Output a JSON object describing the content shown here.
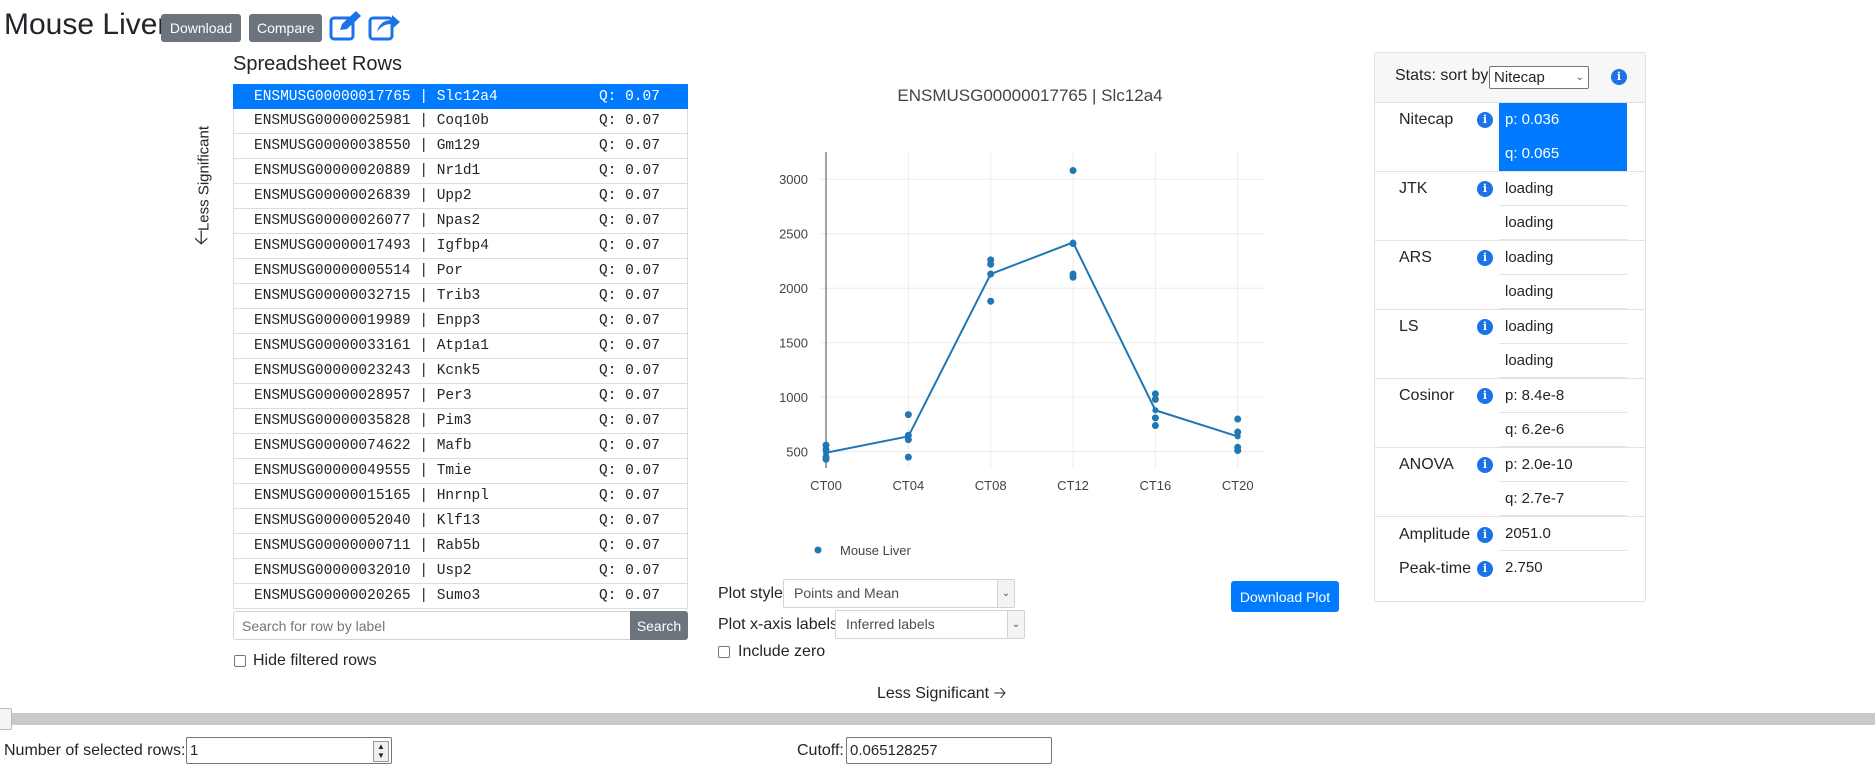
{
  "header": {
    "title": "Mouse Liver",
    "download_label": "Download",
    "compare_label": "Compare",
    "edit_icon": "edit-icon",
    "share_icon": "share-icon"
  },
  "spreadsheet": {
    "heading": "Spreadsheet Rows",
    "less_significant": "Less Significant",
    "rows": [
      {
        "label": "ENSMUSG00000017765 | Slc12a4",
        "q": "Q: 0.07",
        "selected": true
      },
      {
        "label": "ENSMUSG00000025981 | Coq10b",
        "q": "Q: 0.07"
      },
      {
        "label": "ENSMUSG00000038550 | Gm129",
        "q": "Q: 0.07"
      },
      {
        "label": "ENSMUSG00000020889 | Nr1d1",
        "q": "Q: 0.07"
      },
      {
        "label": "ENSMUSG00000026839 | Upp2",
        "q": "Q: 0.07"
      },
      {
        "label": "ENSMUSG00000026077 | Npas2",
        "q": "Q: 0.07"
      },
      {
        "label": "ENSMUSG00000017493 | Igfbp4",
        "q": "Q: 0.07"
      },
      {
        "label": "ENSMUSG00000005514 | Por",
        "q": "Q: 0.07"
      },
      {
        "label": "ENSMUSG00000032715 | Trib3",
        "q": "Q: 0.07"
      },
      {
        "label": "ENSMUSG00000019989 | Enpp3",
        "q": "Q: 0.07"
      },
      {
        "label": "ENSMUSG00000033161 | Atp1a1",
        "q": "Q: 0.07"
      },
      {
        "label": "ENSMUSG00000023243 | Kcnk5",
        "q": "Q: 0.07"
      },
      {
        "label": "ENSMUSG00000028957 | Per3",
        "q": "Q: 0.07"
      },
      {
        "label": "ENSMUSG00000035828 | Pim3",
        "q": "Q: 0.07"
      },
      {
        "label": "ENSMUSG00000074622 | Mafb",
        "q": "Q: 0.07"
      },
      {
        "label": "ENSMUSG00000049555 | Tmie",
        "q": "Q: 0.07"
      },
      {
        "label": "ENSMUSG00000015165 | Hnrnpl",
        "q": "Q: 0.07"
      },
      {
        "label": "ENSMUSG00000052040 | Klf13",
        "q": "Q: 0.07"
      },
      {
        "label": "ENSMUSG00000000711 | Rab5b",
        "q": "Q: 0.07"
      },
      {
        "label": "ENSMUSG00000032010 | Usp2",
        "q": "Q: 0.07"
      },
      {
        "label": "ENSMUSG00000020265 | Sumo3",
        "q": "Q: 0.07"
      }
    ],
    "search_placeholder": "Search for row by label",
    "search_label": "Search",
    "hide_filtered_label": "Hide filtered rows"
  },
  "plot_controls": {
    "plot_style_label": "Plot style",
    "plot_style_value": "Points and Mean",
    "xaxis_labels_label": "Plot x-axis labels",
    "xaxis_labels_value": "Inferred labels",
    "include_zero_label": "Include zero",
    "download_plot_label": "Download Plot",
    "less_significant": "Less Significant"
  },
  "chart_data": {
    "type": "line",
    "title": "ENSMUSG00000017765 | Slc12a4",
    "categories": [
      "CT00",
      "CT04",
      "CT08",
      "CT12",
      "CT16",
      "CT20"
    ],
    "series": [
      {
        "name": "Mouse Liver",
        "mean": [
          490,
          640,
          2130,
          2420,
          880,
          640
        ],
        "points": [
          [
            560,
            520,
            450,
            430
          ],
          [
            840,
            650,
            610,
            450
          ],
          [
            2260,
            2220,
            2130,
            1880
          ],
          [
            3080,
            2410,
            2130,
            2100
          ],
          [
            1030,
            980,
            810,
            740
          ],
          [
            800,
            680,
            540,
            510
          ]
        ]
      }
    ],
    "yticks": [
      500,
      1000,
      1500,
      2000,
      2500,
      3000
    ],
    "ylim": [
      350,
      3250
    ],
    "grid": true,
    "legend": "bottom-center",
    "color": "#1f77b4"
  },
  "stats": {
    "sort_label": "Stats: sort by",
    "sort_value": "Nitecap",
    "rows": [
      {
        "name": "Nitecap",
        "p": "p: 0.036",
        "q": "q: 0.065",
        "highlight": true
      },
      {
        "name": "JTK",
        "p": "loading",
        "q": "loading"
      },
      {
        "name": "ARS",
        "p": "loading",
        "q": "loading"
      },
      {
        "name": "LS",
        "p": "loading",
        "q": "loading"
      },
      {
        "name": "Cosinor",
        "p": "p: 8.4e-8",
        "q": "q: 6.2e-6"
      },
      {
        "name": "ANOVA",
        "p": "p: 2.0e-10",
        "q": "q: 2.7e-7"
      }
    ],
    "amplitude_label": "Amplitude",
    "amplitude_value": "2051.0",
    "peak_label": "Peak-time",
    "peak_value": "2.750"
  },
  "footer": {
    "num_rows_label": "Number of selected rows:",
    "num_rows_value": "1",
    "cutoff_label": "Cutoff:",
    "cutoff_value": "0.065128257"
  },
  "colors": {
    "primary": "#007bff",
    "secondary": "#6c757d",
    "plot": "#1f77b4"
  }
}
